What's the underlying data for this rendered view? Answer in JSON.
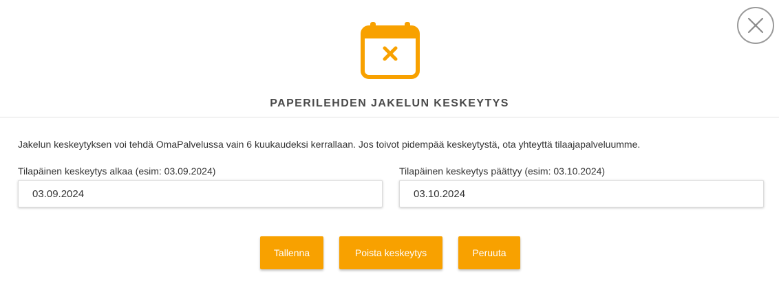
{
  "dialog": {
    "title": "PAPERILEHDEN JAKELUN KESKEYTYS",
    "header_icon": "calendar-cancel-icon",
    "close_icon": "close-icon",
    "info_text": "Jakelun keskeytyksen voi tehdä OmaPalvelussa vain 6 kuukaudeksi kerrallaan. Jos toivot pidempää keskeytystä, ota yhteyttä tilaajapalveluumme."
  },
  "form": {
    "start": {
      "label": "Tilapäinen keskeytys alkaa (esim: 03.09.2024)",
      "value": "03.09.2024"
    },
    "end": {
      "label": "Tilapäinen keskeytys päättyy (esim: 03.10.2024)",
      "value": "03.10.2024"
    }
  },
  "buttons": {
    "save": "Tallenna",
    "remove": "Poista keskeytys",
    "cancel": "Peruuta"
  },
  "colors": {
    "accent": "#f8a100",
    "title_text": "#4a4a4a",
    "close_border": "#9a9a9a"
  }
}
